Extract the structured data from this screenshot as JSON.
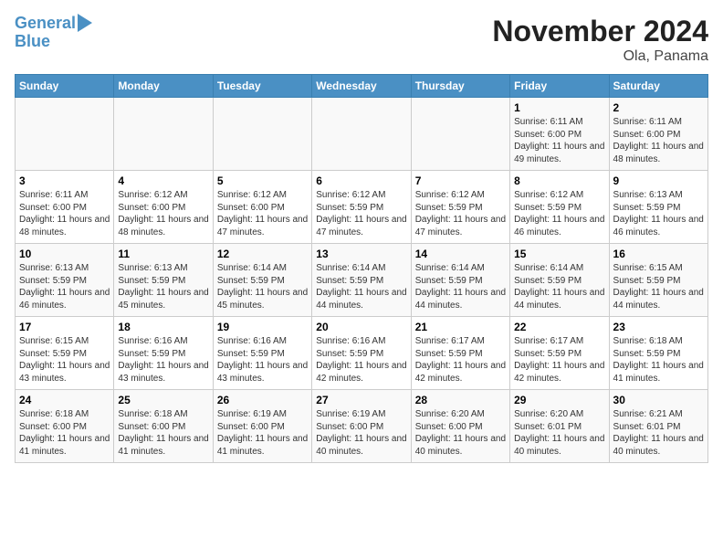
{
  "logo": {
    "line1": "General",
    "line2": "Blue"
  },
  "title": "November 2024",
  "subtitle": "Ola, Panama",
  "days_of_week": [
    "Sunday",
    "Monday",
    "Tuesday",
    "Wednesday",
    "Thursday",
    "Friday",
    "Saturday"
  ],
  "weeks": [
    [
      {
        "day": null
      },
      {
        "day": null
      },
      {
        "day": null
      },
      {
        "day": null
      },
      {
        "day": null
      },
      {
        "day": "1",
        "sunrise": "Sunrise: 6:11 AM",
        "sunset": "Sunset: 6:00 PM",
        "daylight": "Daylight: 11 hours and 49 minutes."
      },
      {
        "day": "2",
        "sunrise": "Sunrise: 6:11 AM",
        "sunset": "Sunset: 6:00 PM",
        "daylight": "Daylight: 11 hours and 48 minutes."
      }
    ],
    [
      {
        "day": "3",
        "sunrise": "Sunrise: 6:11 AM",
        "sunset": "Sunset: 6:00 PM",
        "daylight": "Daylight: 11 hours and 48 minutes."
      },
      {
        "day": "4",
        "sunrise": "Sunrise: 6:12 AM",
        "sunset": "Sunset: 6:00 PM",
        "daylight": "Daylight: 11 hours and 48 minutes."
      },
      {
        "day": "5",
        "sunrise": "Sunrise: 6:12 AM",
        "sunset": "Sunset: 6:00 PM",
        "daylight": "Daylight: 11 hours and 47 minutes."
      },
      {
        "day": "6",
        "sunrise": "Sunrise: 6:12 AM",
        "sunset": "Sunset: 5:59 PM",
        "daylight": "Daylight: 11 hours and 47 minutes."
      },
      {
        "day": "7",
        "sunrise": "Sunrise: 6:12 AM",
        "sunset": "Sunset: 5:59 PM",
        "daylight": "Daylight: 11 hours and 47 minutes."
      },
      {
        "day": "8",
        "sunrise": "Sunrise: 6:12 AM",
        "sunset": "Sunset: 5:59 PM",
        "daylight": "Daylight: 11 hours and 46 minutes."
      },
      {
        "day": "9",
        "sunrise": "Sunrise: 6:13 AM",
        "sunset": "Sunset: 5:59 PM",
        "daylight": "Daylight: 11 hours and 46 minutes."
      }
    ],
    [
      {
        "day": "10",
        "sunrise": "Sunrise: 6:13 AM",
        "sunset": "Sunset: 5:59 PM",
        "daylight": "Daylight: 11 hours and 46 minutes."
      },
      {
        "day": "11",
        "sunrise": "Sunrise: 6:13 AM",
        "sunset": "Sunset: 5:59 PM",
        "daylight": "Daylight: 11 hours and 45 minutes."
      },
      {
        "day": "12",
        "sunrise": "Sunrise: 6:14 AM",
        "sunset": "Sunset: 5:59 PM",
        "daylight": "Daylight: 11 hours and 45 minutes."
      },
      {
        "day": "13",
        "sunrise": "Sunrise: 6:14 AM",
        "sunset": "Sunset: 5:59 PM",
        "daylight": "Daylight: 11 hours and 44 minutes."
      },
      {
        "day": "14",
        "sunrise": "Sunrise: 6:14 AM",
        "sunset": "Sunset: 5:59 PM",
        "daylight": "Daylight: 11 hours and 44 minutes."
      },
      {
        "day": "15",
        "sunrise": "Sunrise: 6:14 AM",
        "sunset": "Sunset: 5:59 PM",
        "daylight": "Daylight: 11 hours and 44 minutes."
      },
      {
        "day": "16",
        "sunrise": "Sunrise: 6:15 AM",
        "sunset": "Sunset: 5:59 PM",
        "daylight": "Daylight: 11 hours and 44 minutes."
      }
    ],
    [
      {
        "day": "17",
        "sunrise": "Sunrise: 6:15 AM",
        "sunset": "Sunset: 5:59 PM",
        "daylight": "Daylight: 11 hours and 43 minutes."
      },
      {
        "day": "18",
        "sunrise": "Sunrise: 6:16 AM",
        "sunset": "Sunset: 5:59 PM",
        "daylight": "Daylight: 11 hours and 43 minutes."
      },
      {
        "day": "19",
        "sunrise": "Sunrise: 6:16 AM",
        "sunset": "Sunset: 5:59 PM",
        "daylight": "Daylight: 11 hours and 43 minutes."
      },
      {
        "day": "20",
        "sunrise": "Sunrise: 6:16 AM",
        "sunset": "Sunset: 5:59 PM",
        "daylight": "Daylight: 11 hours and 42 minutes."
      },
      {
        "day": "21",
        "sunrise": "Sunrise: 6:17 AM",
        "sunset": "Sunset: 5:59 PM",
        "daylight": "Daylight: 11 hours and 42 minutes."
      },
      {
        "day": "22",
        "sunrise": "Sunrise: 6:17 AM",
        "sunset": "Sunset: 5:59 PM",
        "daylight": "Daylight: 11 hours and 42 minutes."
      },
      {
        "day": "23",
        "sunrise": "Sunrise: 6:18 AM",
        "sunset": "Sunset: 5:59 PM",
        "daylight": "Daylight: 11 hours and 41 minutes."
      }
    ],
    [
      {
        "day": "24",
        "sunrise": "Sunrise: 6:18 AM",
        "sunset": "Sunset: 6:00 PM",
        "daylight": "Daylight: 11 hours and 41 minutes."
      },
      {
        "day": "25",
        "sunrise": "Sunrise: 6:18 AM",
        "sunset": "Sunset: 6:00 PM",
        "daylight": "Daylight: 11 hours and 41 minutes."
      },
      {
        "day": "26",
        "sunrise": "Sunrise: 6:19 AM",
        "sunset": "Sunset: 6:00 PM",
        "daylight": "Daylight: 11 hours and 41 minutes."
      },
      {
        "day": "27",
        "sunrise": "Sunrise: 6:19 AM",
        "sunset": "Sunset: 6:00 PM",
        "daylight": "Daylight: 11 hours and 40 minutes."
      },
      {
        "day": "28",
        "sunrise": "Sunrise: 6:20 AM",
        "sunset": "Sunset: 6:00 PM",
        "daylight": "Daylight: 11 hours and 40 minutes."
      },
      {
        "day": "29",
        "sunrise": "Sunrise: 6:20 AM",
        "sunset": "Sunset: 6:01 PM",
        "daylight": "Daylight: 11 hours and 40 minutes."
      },
      {
        "day": "30",
        "sunrise": "Sunrise: 6:21 AM",
        "sunset": "Sunset: 6:01 PM",
        "daylight": "Daylight: 11 hours and 40 minutes."
      }
    ]
  ]
}
